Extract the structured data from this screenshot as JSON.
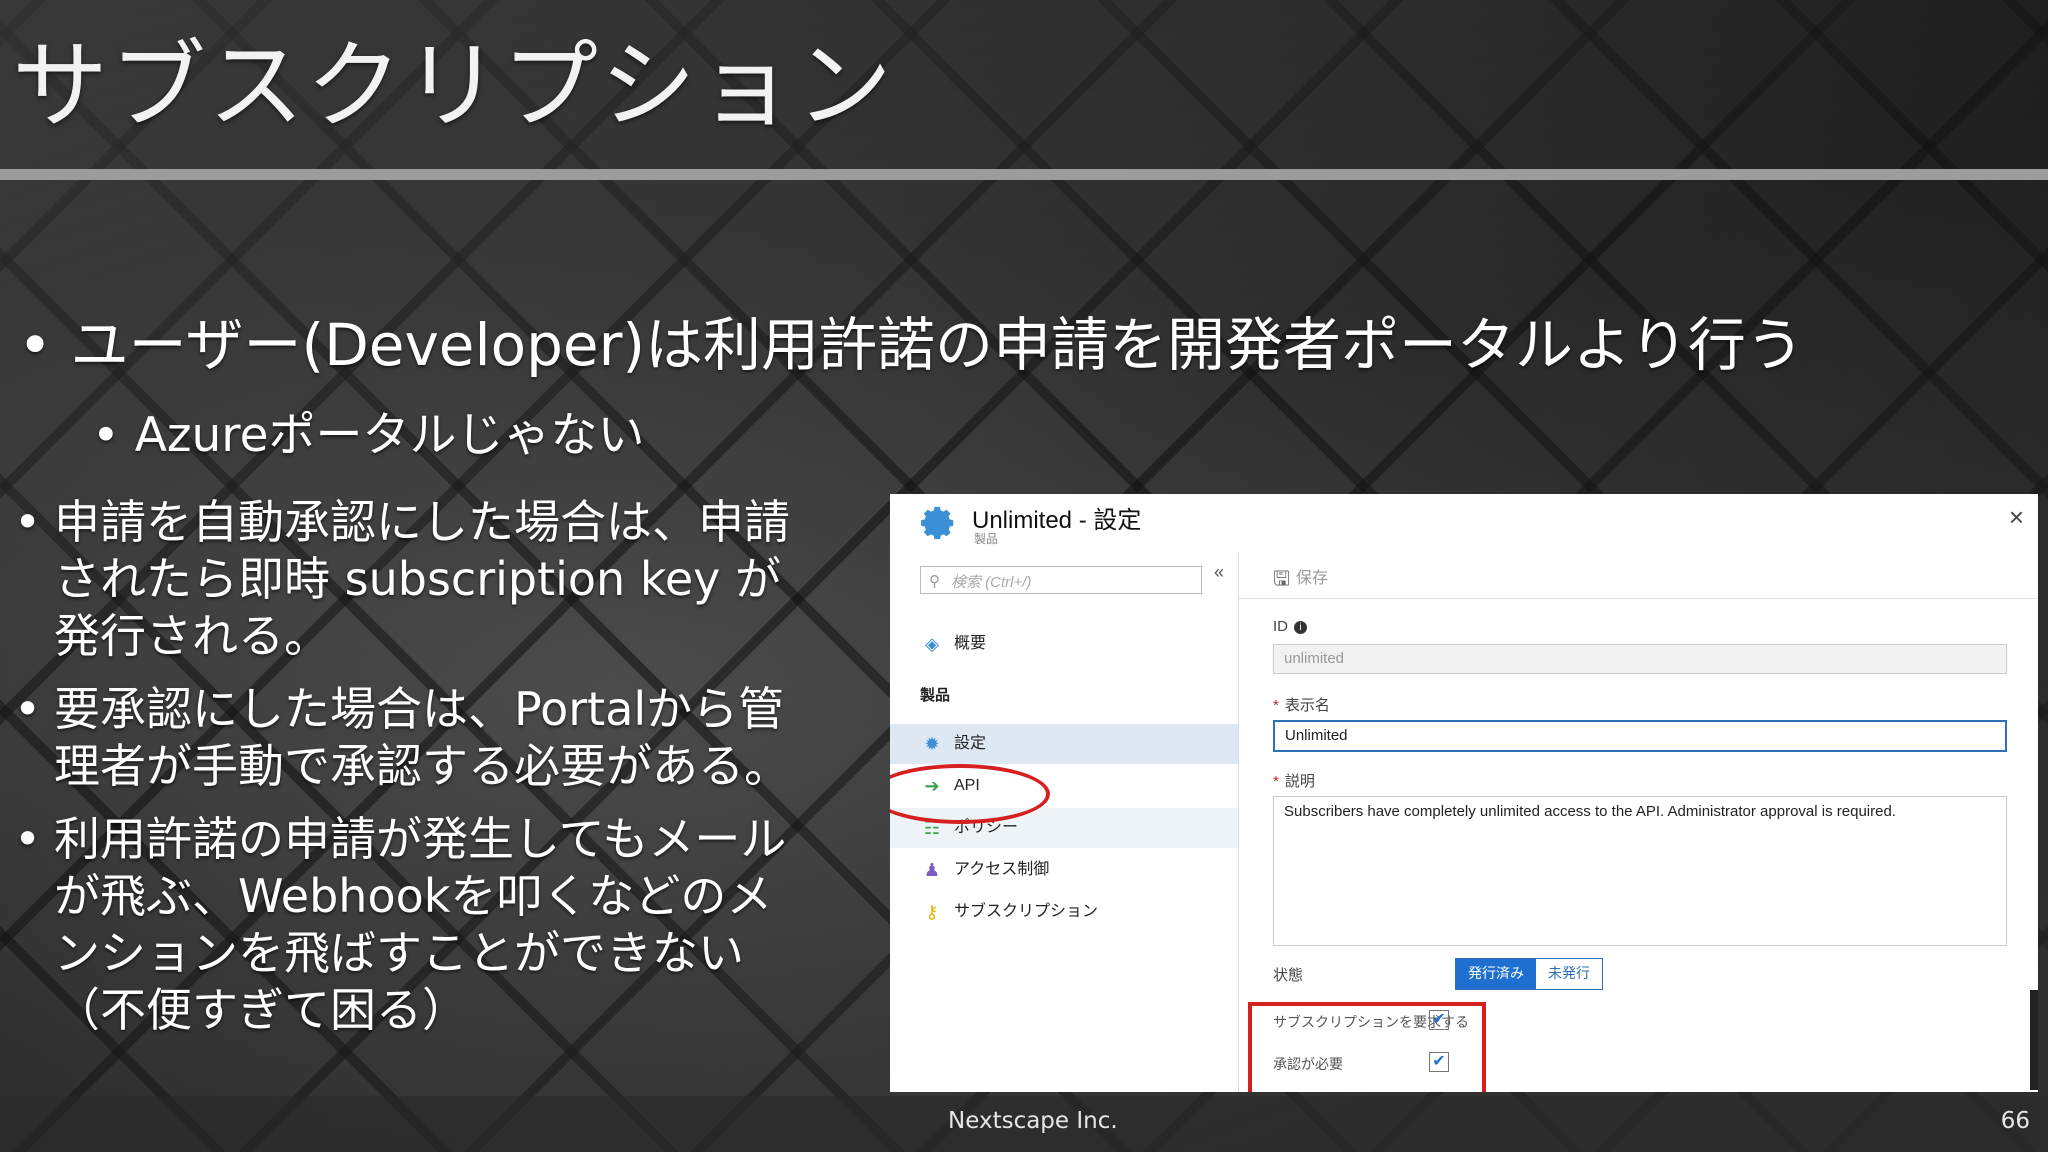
{
  "slide": {
    "title": "サブスクリプション",
    "bullet1": "ユーザー(Developer)は利用許諾の申請を開発者ポータルより行う",
    "bullet1_sub": "Azureポータルじゃない",
    "bullets": [
      "申請を自動承認にした場合は、申請されたら即時 subscription key が発行される。",
      "要承認にした場合は、Portalから管理者が手動で承認する必要がある。",
      "利用許諾の申請が発生してもメールが飛ぶ、Webhookを叩くなどのメンションを飛ばすことができない（不便すぎて困る）"
    ],
    "bullet_glyph": "•"
  },
  "screenshot": {
    "title": "Unlimited - 設定",
    "subtitle": "製品",
    "close_glyph": "×",
    "search_placeholder": "検索 (Ctrl+/)",
    "collapse_glyph": "«",
    "nav": {
      "overview": "概要",
      "section": "製品",
      "settings": "設定",
      "api": "API",
      "policy": "ポリシー",
      "access": "アクセス制御",
      "subscription": "サブスクリプション"
    },
    "toolbar": {
      "save": "保存"
    },
    "fields": {
      "id_label": "ID",
      "id_value": "unlimited",
      "display_label": "表示名",
      "display_value": "Unlimited",
      "desc_label": "説明",
      "desc_value": "Subscribers have completely unlimited access to the API. Administrator approval is required.",
      "state_label": "状態",
      "state_published": "発行済み",
      "state_unpublished": "未発行",
      "require_sub_label": "サブスクリプションを要求する",
      "approval_label": "承認が必要"
    },
    "accent_color": "#1f6fd1",
    "highlight_color": "#d62020"
  },
  "footer": {
    "company": "Nextscape Inc.",
    "page": "66"
  }
}
